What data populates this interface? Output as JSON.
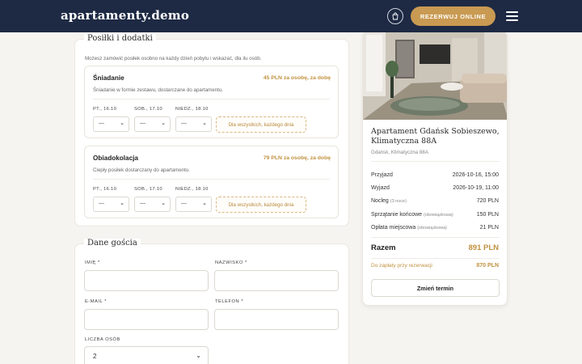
{
  "header": {
    "brand": "apartamenty.demo",
    "book_label": "REZERWUJ ONLINE",
    "colors": {
      "bg": "#1e2a44",
      "accent": "#c99a52"
    }
  },
  "meals": {
    "title": "Posiłki i dodatki",
    "intro": "Możesz zamówić posiłek osobno na każdy dzień pobytu i wskazać, dla ilu osób.",
    "items": [
      {
        "name": "Śniadanie",
        "price": "45 PLN za osobę, za dobę",
        "description": "Śniadanie w formie zestawu, dostarczane do apartamentu.",
        "days": [
          {
            "label": "PT., 16.10",
            "value": "—"
          },
          {
            "label": "SOB., 17.10",
            "value": "—"
          },
          {
            "label": "NIEDZ., 18.10",
            "value": "—"
          }
        ],
        "all_days_label": "Dla wszystkich, każdego dnia"
      },
      {
        "name": "Obiadokolacja",
        "price": "79 PLN za osobę, za dobę",
        "description": "Ciepły posiłek dostarczany do apartamentu.",
        "days": [
          {
            "label": "PT., 16.10",
            "value": "—"
          },
          {
            "label": "SOB., 17.10",
            "value": "—"
          },
          {
            "label": "NIEDZ., 18.10",
            "value": "—"
          }
        ],
        "all_days_label": "Dla wszystkich, każdego dnia"
      }
    ]
  },
  "guest": {
    "title": "Dane gościa",
    "first_name_label": "IMIĘ *",
    "last_name_label": "NAZWISKO *",
    "email_label": "E-MAIL *",
    "phone_label": "TELEFON *",
    "guests_label": "LICZBA OSÓB",
    "guests_value": "2"
  },
  "summary": {
    "name": "Apartament Gdańsk Sobieszewo, Klimatyczna 88A",
    "location": "Gdańsk, Klimatyczna 88A",
    "rows": [
      {
        "label": "Przyjazd",
        "sub": "",
        "value": "2026-10-16, 15:00"
      },
      {
        "label": "Wyjazd",
        "sub": "",
        "value": "2026-10-19, 11:00"
      },
      {
        "label": "Nocleg",
        "sub": "(3 noce)",
        "value": "720 PLN"
      },
      {
        "label": "Sprzątanie końcowe",
        "sub": "(obowiązkowa)",
        "value": "150 PLN"
      },
      {
        "label": "Opłata miejscowa",
        "sub": "(obowiązkowa)",
        "value": "21 PLN"
      }
    ],
    "total_label": "Razem",
    "total_value": "891 PLN",
    "due_label": "Do zapłaty przy rezerwacji",
    "due_value": "870 PLN",
    "change_label": "Zmień termin"
  }
}
